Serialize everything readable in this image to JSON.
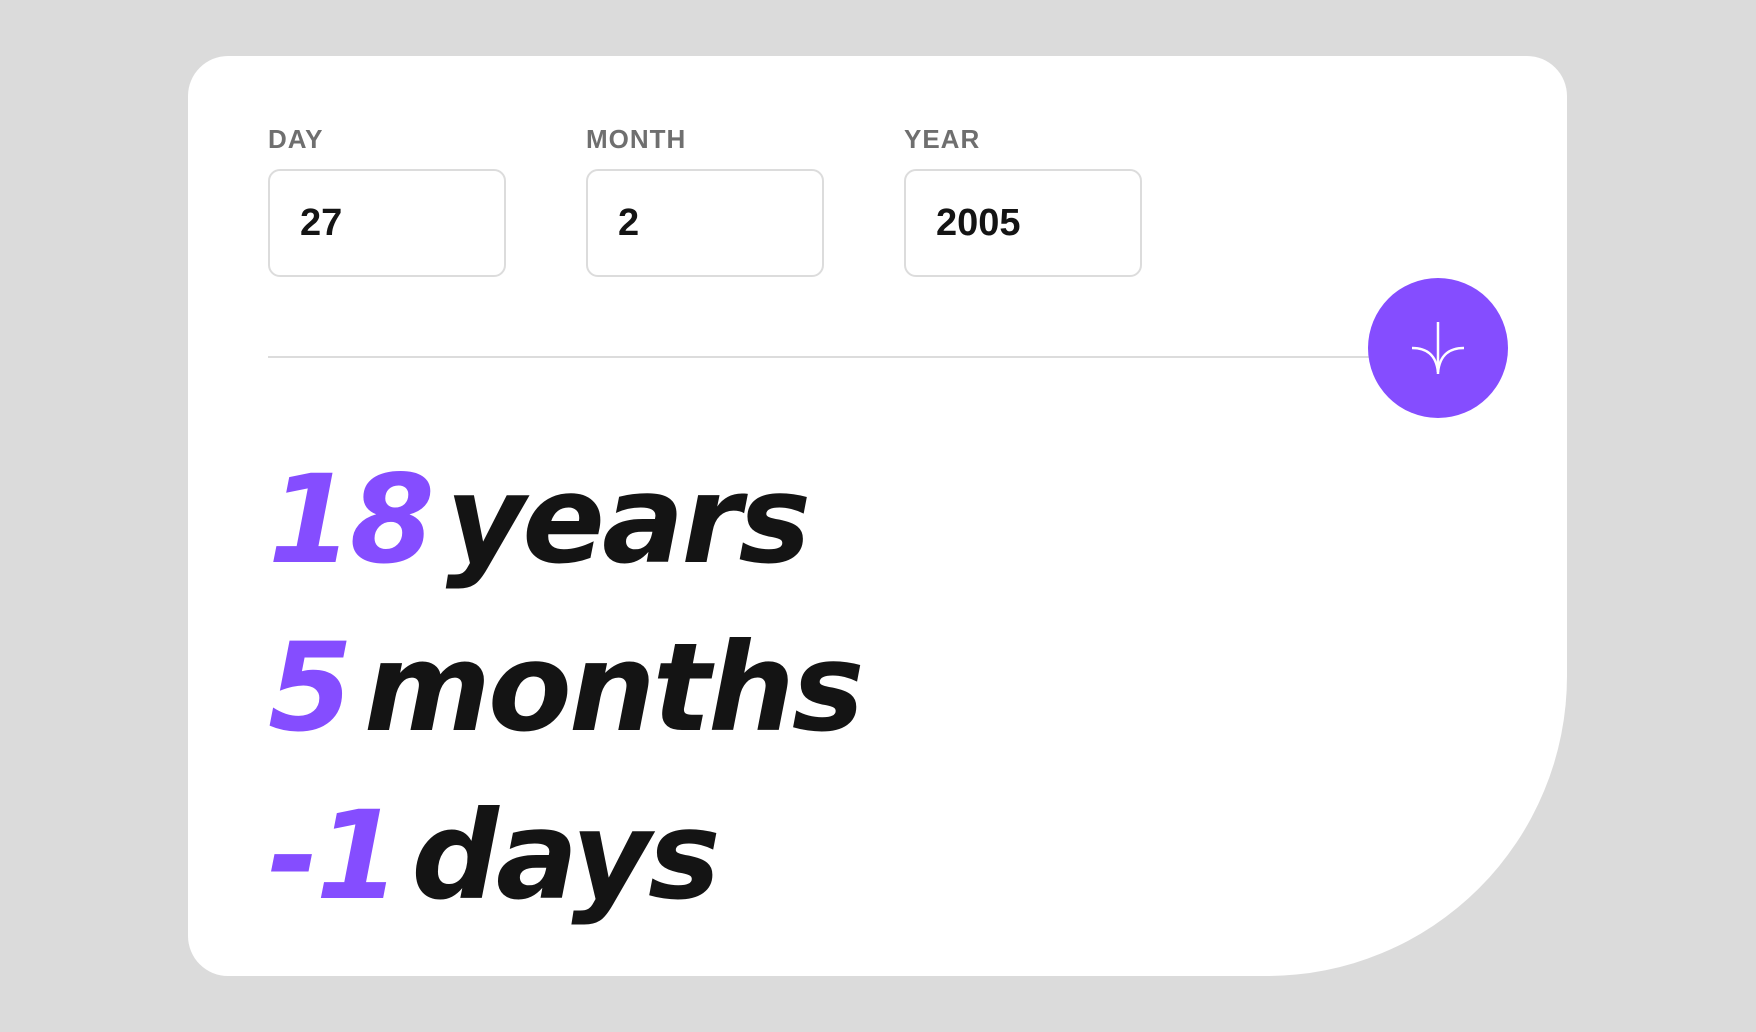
{
  "form": {
    "day": {
      "label": "DAY",
      "value": "27"
    },
    "month": {
      "label": "MONTH",
      "value": "2"
    },
    "year": {
      "label": "YEAR",
      "value": "2005"
    }
  },
  "submit": {
    "icon": "arrow-down-icon",
    "color": "#854dff"
  },
  "results": {
    "years": {
      "value": "18",
      "unit": "years"
    },
    "months": {
      "value": "5",
      "unit": "months"
    },
    "days": {
      "value": "-1",
      "unit": "days"
    }
  },
  "colors": {
    "accent": "#854dff",
    "background": "#dbdbdb",
    "card": "#ffffff",
    "text": "#141414",
    "label": "#6f6f6f",
    "border": "#dcdcdc"
  }
}
